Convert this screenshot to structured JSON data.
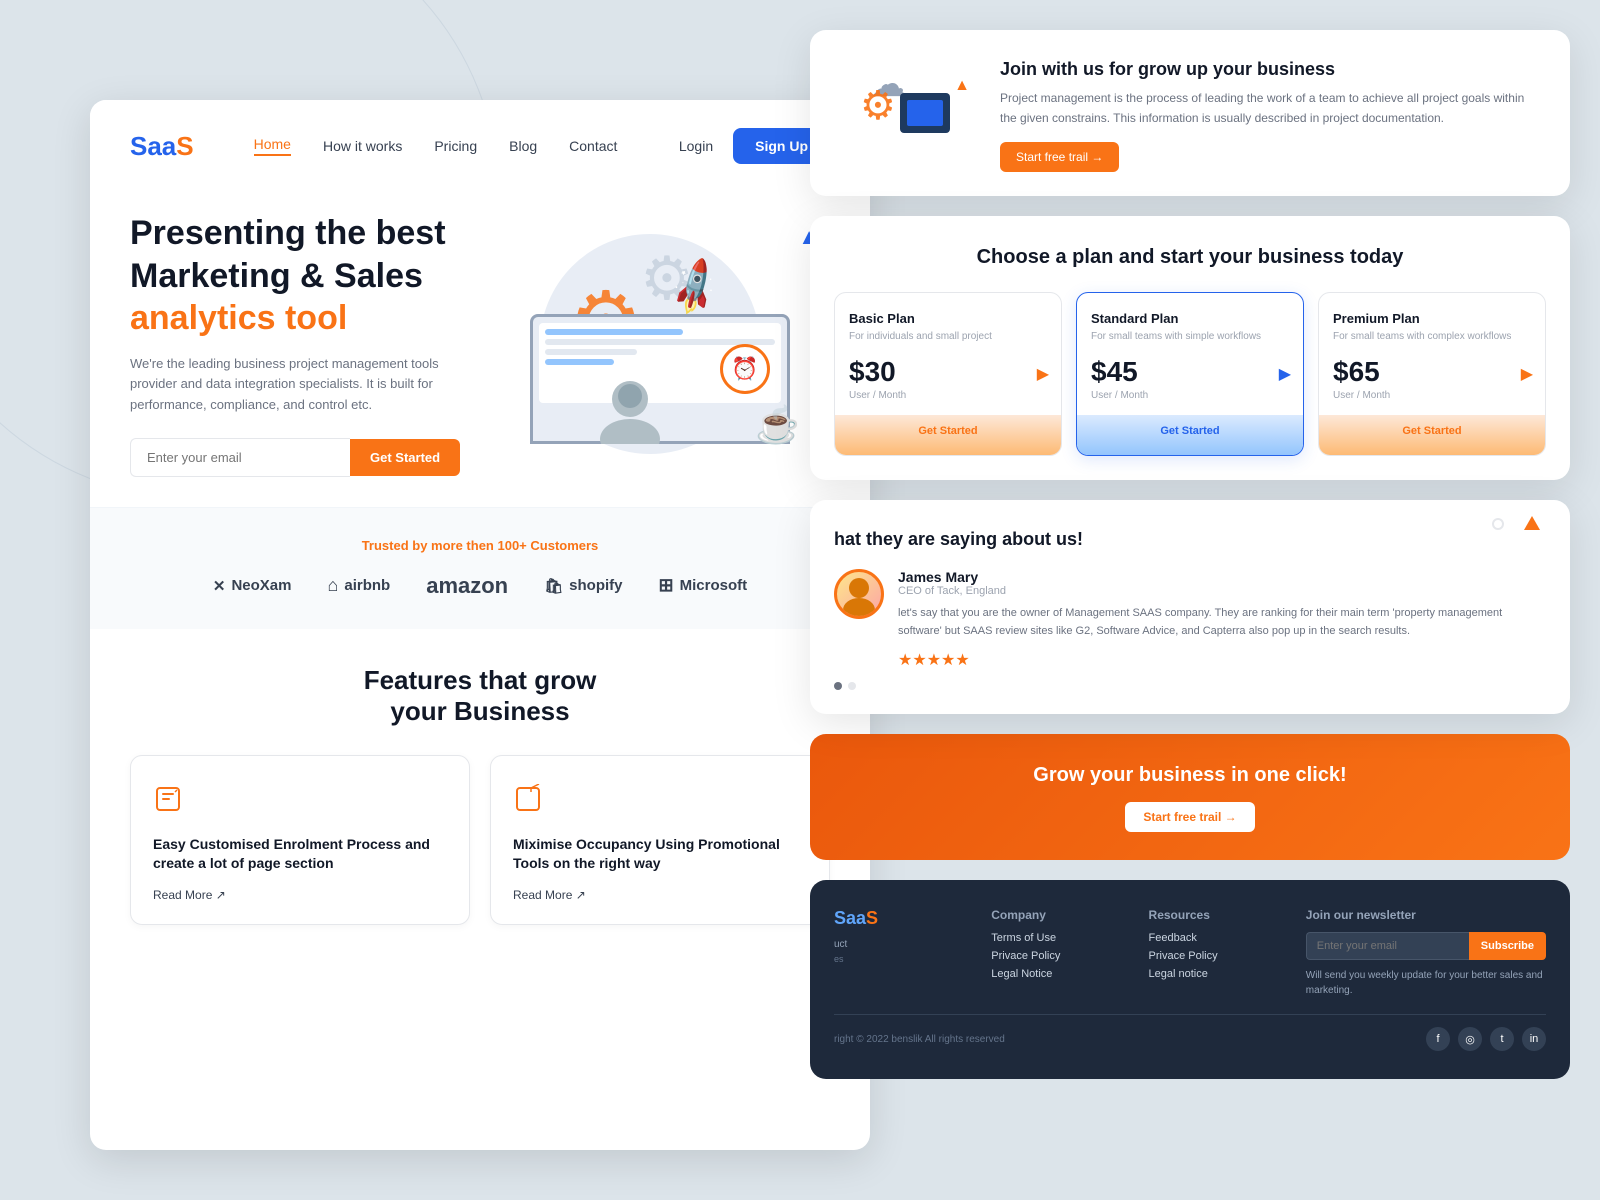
{
  "site": {
    "logo_blue": "Saa",
    "logo_orange": "S"
  },
  "navbar": {
    "links": [
      "Home",
      "How it works",
      "Pricing",
      "Blog",
      "Contact"
    ],
    "active": "Home",
    "login_label": "Login",
    "signup_label": "Sign Up"
  },
  "hero": {
    "title_line1": "Presenting the best",
    "title_line2": "Marketing & Sales",
    "title_orange": "analytics tool",
    "description": "We're the leading business project management tools provider and  data integration specialists. It is built for performance, compliance, and control etc.",
    "email_placeholder": "Enter your email",
    "cta_button": "Get Started"
  },
  "trusted": {
    "label": "Trusted by more then 100+ Customers",
    "brands": [
      "NeoXam",
      "airbnb",
      "amazon",
      "shopify",
      "Microsoft"
    ]
  },
  "features": {
    "title_line1": "Features that grow",
    "title_line2": "your Business",
    "cards": [
      {
        "title": "Easy Customised Enrolment Process and create a lot of page section",
        "read_more": "Read More ↗"
      },
      {
        "title": "Miximise Occupancy Using Promotional Tools on the right way",
        "read_more": "Read More ↗"
      }
    ]
  },
  "join": {
    "title": "Join with us for grow up your business",
    "description": "Project management is the process of leading the work of a team to achieve all project goals within the given constrains. This information is usually described in project documentation.",
    "cta": "Start free trail →"
  },
  "pricing": {
    "title": "Choose a plan and  start your business today",
    "plans": [
      {
        "name": "Basic Plan",
        "desc": "For individuals and small project",
        "price": "$30",
        "period": "User / Month",
        "cta": "Get Started",
        "style": "basic"
      },
      {
        "name": "Standard Plan",
        "desc": "For small teams with simple workflows",
        "price": "$45",
        "period": "User / Month",
        "cta": "Get Started",
        "style": "standard"
      },
      {
        "name": "Premium Plan",
        "desc": "For small teams with complex workflows",
        "price": "$65",
        "period": "User / Month",
        "cta": "Get Started",
        "style": "premium"
      }
    ]
  },
  "testimonial": {
    "partial_text": "hat they are saying about us!",
    "person": {
      "name": "James Mary",
      "role": "CEO of Tack, England"
    },
    "quote": "let's say that you are the owner of Management SAAS company. They are ranking for their main term 'property management software' but SAAS review sites like G2, Software Advice, and Capterra also pop up in the search results.",
    "stars": 5
  },
  "cta": {
    "title": "Grow your business in one click!",
    "button": "Start free trail →"
  },
  "footer": {
    "logo_blue": "aa",
    "logo_orange": "S",
    "product_label": "uct",
    "columns": {
      "company": {
        "title": "Company",
        "links": [
          "Terms of Use",
          "Privace Policy",
          "Legal Notice"
        ]
      },
      "resources": {
        "title": "Resources",
        "links": [
          "Feedback",
          "Privace Policy",
          "Legal notice"
        ]
      },
      "newsletter": {
        "title": "Join our newsletter",
        "placeholder": "Enter your email",
        "subscribe": "Subscribe",
        "desc": "Will send you weekly update for your better sales and marketing."
      }
    },
    "copyright": "right © 2022 benslik All rights reserved",
    "socials": [
      "f",
      "©",
      "🐦",
      "in"
    ]
  }
}
